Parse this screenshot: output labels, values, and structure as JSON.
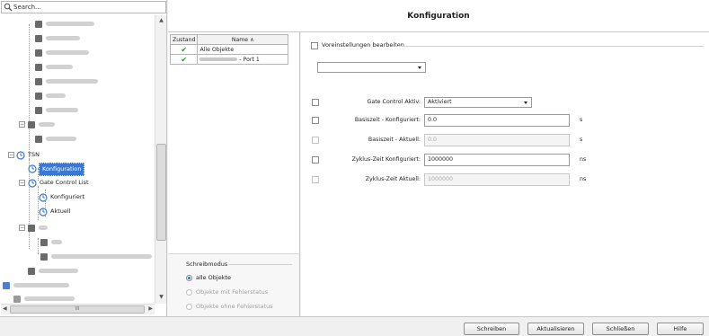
{
  "search": {
    "placeholder": "Search..."
  },
  "tree": {
    "tsn_label": "TSN",
    "konfiguration_label": "Konfiguration",
    "gate_control_list_label": "Gate Control List",
    "konfiguriert_label": "Konfiguriert",
    "aktuell_label": "Aktuell",
    "hscroll_grip": "III"
  },
  "header": {
    "title": "Konfiguration"
  },
  "object_table": {
    "headers": {
      "status": "Zustand",
      "name": "Name ∧"
    },
    "rows": [
      {
        "status_icon": "✔",
        "name": "Alle Objekte"
      },
      {
        "status_icon": "✔",
        "name": "- Port 1"
      }
    ]
  },
  "write_mode": {
    "title": "Schreibmodus",
    "options": [
      {
        "label": "alle Objekte",
        "selected": true,
        "enabled": true
      },
      {
        "label": "Objekte mit Fehlerstatus",
        "selected": false,
        "enabled": false
      },
      {
        "label": "Objekte ohne Fehlerstatus",
        "selected": false,
        "enabled": false
      }
    ]
  },
  "settings": {
    "preset_label": "Voreinstellungen bearbeiten",
    "preset_value": "",
    "fields": [
      {
        "label": "Gate Control Aktiv:",
        "value": "Aktiviert",
        "unit": ""
      },
      {
        "label": "Basiszeit - Konfiguriert:",
        "value": "0.0",
        "unit": "s"
      },
      {
        "label": "Basiszeit - Aktuell:",
        "value": "0.0",
        "unit": "s"
      },
      {
        "label": "Zyklus-Zeit Konfiguriert:",
        "value": "1000000",
        "unit": "ns"
      },
      {
        "label": "Zyklus-Zeit Aktuell:",
        "value": "1000000",
        "unit": "ns"
      }
    ]
  },
  "buttons": {
    "write": "Schreiben",
    "refresh": "Aktualisieren",
    "close": "Schließen",
    "help": "Hilfe"
  },
  "colors": {
    "selection": "#3a78d6",
    "check_green": "#1d9a1d",
    "tree_icon": "#6a6a6a"
  }
}
